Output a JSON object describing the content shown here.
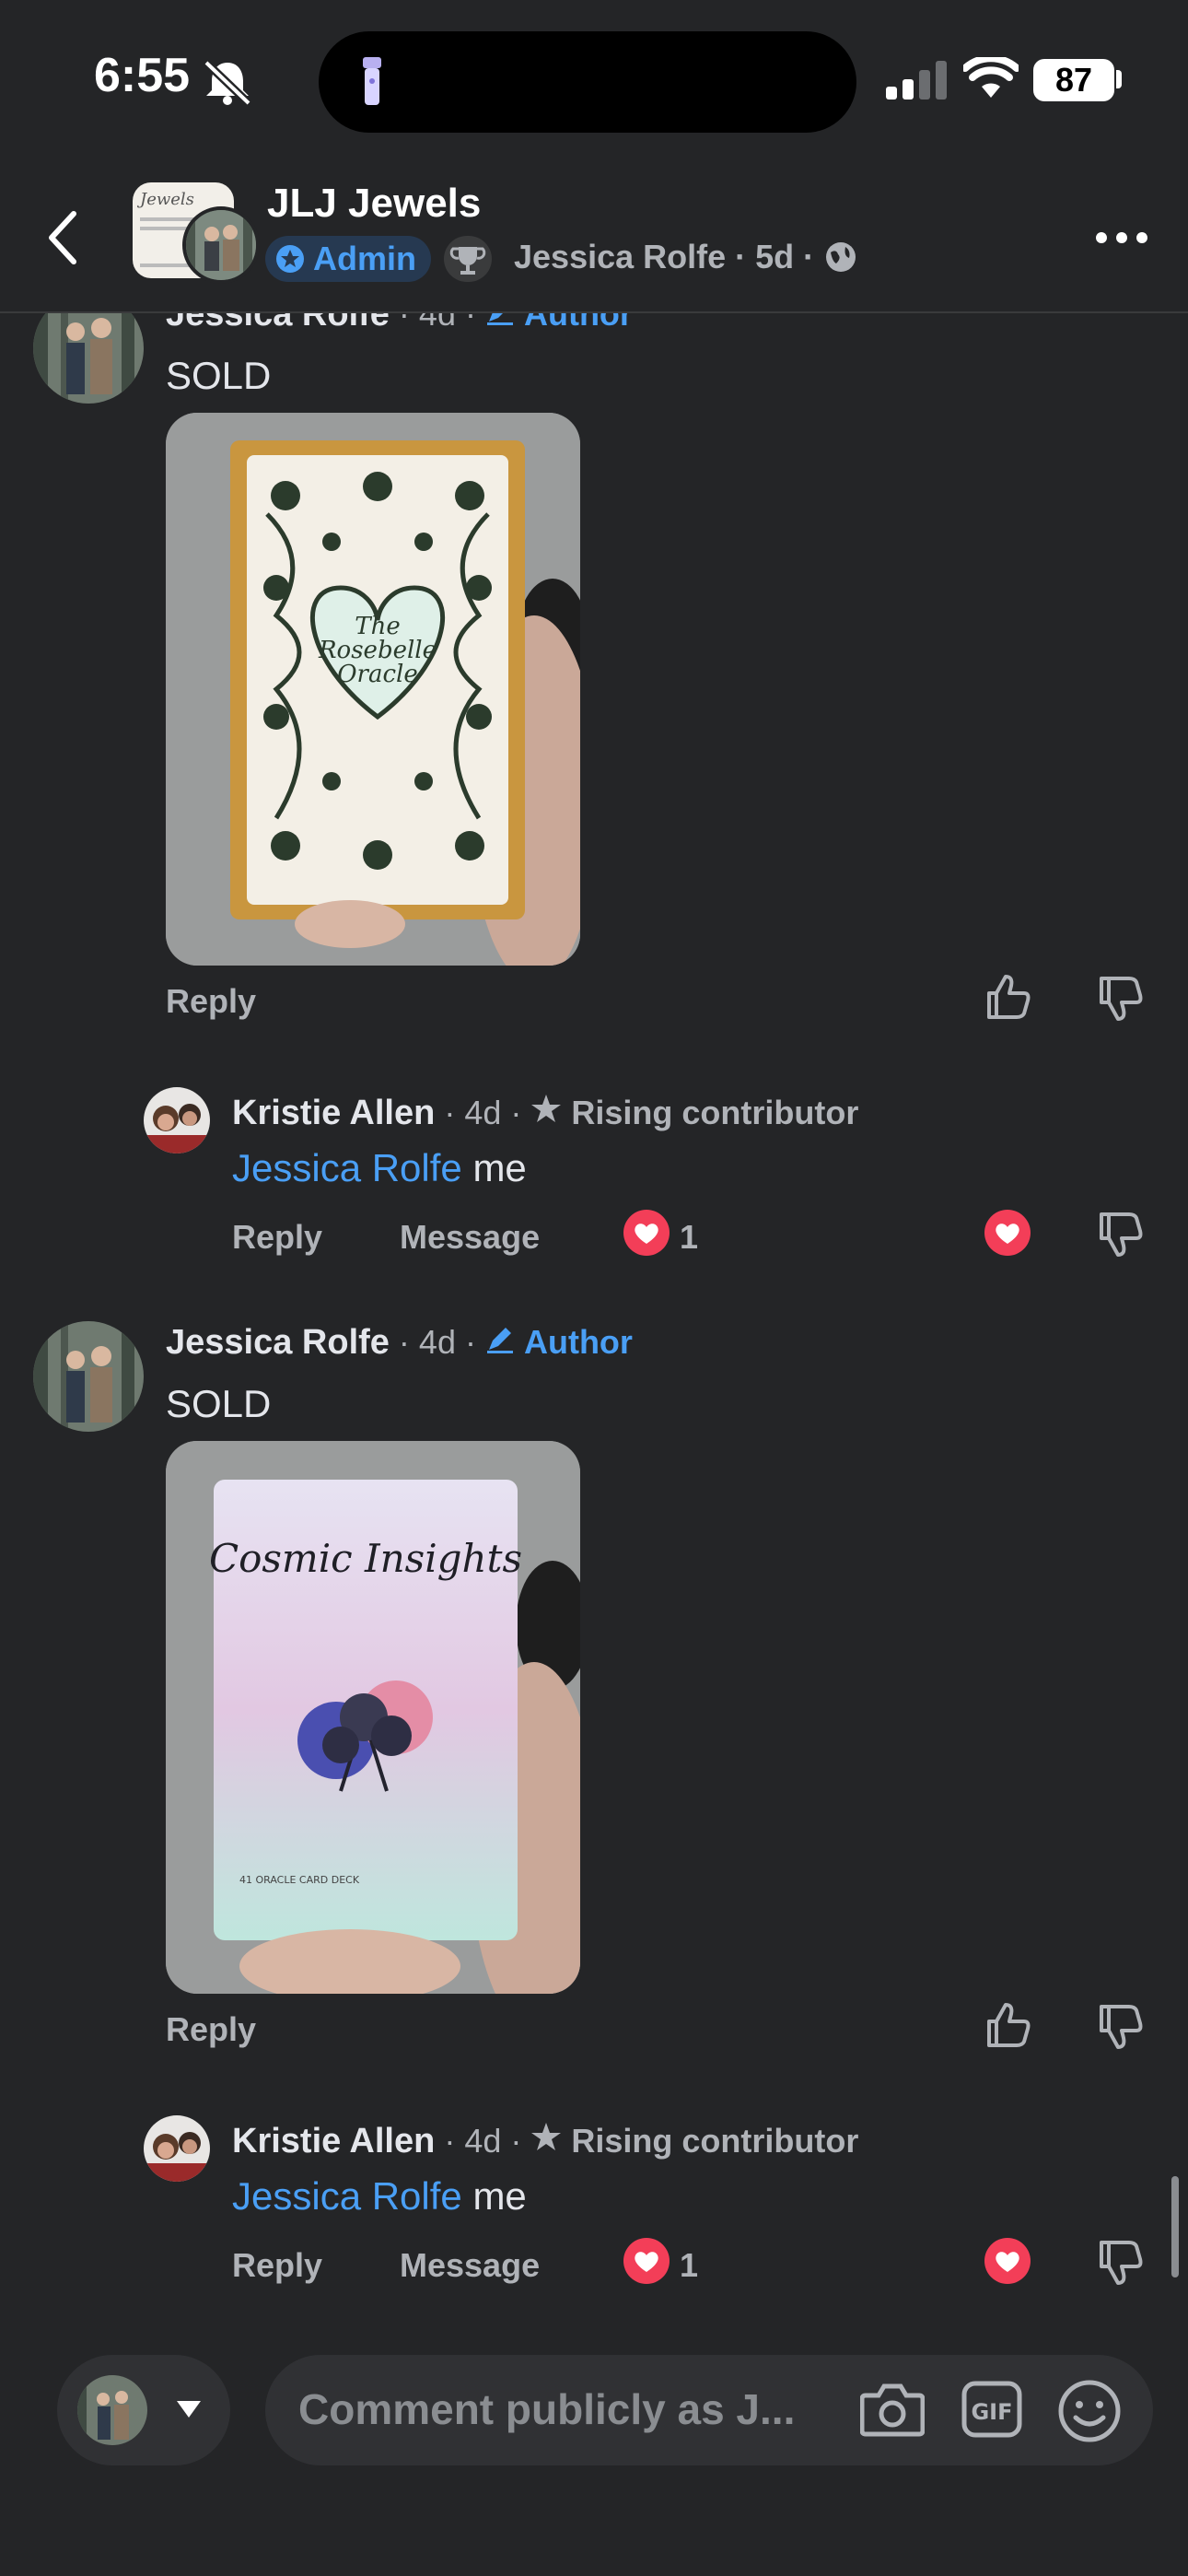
{
  "status": {
    "time": "6:55",
    "battery": "87"
  },
  "header": {
    "title": "JLJ Jewels",
    "admin_label": "Admin",
    "author": "Jessica Rolfe",
    "age": "5d"
  },
  "comments": [
    {
      "name": "Jessica Rolfe",
      "age": "4d",
      "badge": "Author",
      "text": "SOLD",
      "image_text": [
        "The",
        "Rosebelle",
        "Oracle"
      ],
      "reply_label": "Reply"
    },
    {
      "name": "Kristie Allen",
      "age": "4d",
      "badge": "Rising contributor",
      "mention": "Jessica Rolfe",
      "text": "me",
      "reply_label": "Reply",
      "message_label": "Message",
      "reaction_count": "1"
    },
    {
      "name": "Jessica Rolfe",
      "age": "4d",
      "badge": "Author",
      "text": "SOLD",
      "image_text": [
        "Cosmic Insights",
        "41 ORACLE CARD DECK"
      ],
      "reply_label": "Reply"
    },
    {
      "name": "Kristie Allen",
      "age": "4d",
      "badge": "Rising contributor",
      "mention": "Jessica Rolfe",
      "text": "me",
      "reply_label": "Reply",
      "message_label": "Message",
      "reaction_count": "1"
    }
  ],
  "composer": {
    "placeholder": "Comment publicly as J..."
  },
  "colors": {
    "background": "#242527",
    "accent": "#4a9ff5",
    "heart": "#f33e58"
  }
}
